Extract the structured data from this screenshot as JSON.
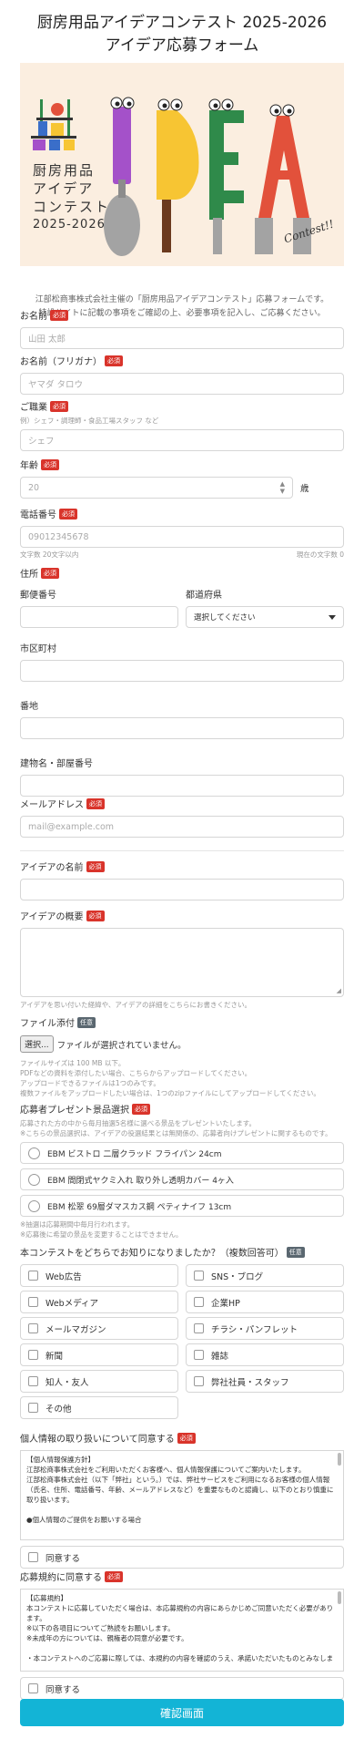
{
  "title": [
    "厨房用品アイデアコンテスト 2025-2026",
    "アイデア応募フォーム"
  ],
  "banner": {
    "text_lines": [
      "厨房用品",
      "アイデア",
      "コンテスト",
      "2025-2026"
    ],
    "logo_letters": [
      "I",
      "D",
      "E",
      "A"
    ],
    "contest_script": "Contest!!",
    "colors": {
      "bg": "#fbeee0",
      "purple": "#a451c9",
      "yellow": "#f7c533",
      "green": "#2f8a4a",
      "red": "#e2513b",
      "blue": "#3a6ec9"
    }
  },
  "intro": [
    "江部松商事株式会社主催の「厨房用品アイデアコンテスト」応募フォームです。",
    "特設サイトに記載の事項をご確認の上、必要事項を記入し、ご応募ください。"
  ],
  "badges": {
    "required": "必須",
    "optional": "任意"
  },
  "form": {
    "name": {
      "label": "お名前",
      "placeholder": "山田 太郎"
    },
    "kana": {
      "label": "お名前（フリガナ）",
      "placeholder": "ヤマダ タロウ"
    },
    "job": {
      "label": "ご職業",
      "hint": "例）シェフ・調理師・食品工場スタッフ など",
      "placeholder": "シェフ"
    },
    "age": {
      "label": "年齢",
      "value": "20",
      "unit": "歳"
    },
    "phone": {
      "label": "電話番号",
      "placeholder": "09012345678",
      "hint_left": "文字数 20文字以内",
      "hint_right": "現在の文字数 0"
    },
    "address": {
      "label": "住所",
      "zip_label": "郵便番号",
      "pref_label": "都道府県",
      "pref_value": "選択してください",
      "city_label": "市区町村",
      "street_label": "番地",
      "building_label": "建物名・部屋番号"
    },
    "email": {
      "label": "メールアドレス",
      "placeholder": "mail@example.com"
    },
    "idea_name": {
      "label": "アイデアの名前"
    },
    "idea_summary": {
      "label": "アイデアの概要",
      "hint": "アイデアを思い付いた経緯や、アイデアの詳細をこちらにお書きください。"
    },
    "file": {
      "label": "ファイル添付",
      "button": "選択...",
      "status": "ファイルが選択されていません。",
      "hints": [
        "ファイルサイズは 100 MB 以下。",
        "PDFなどの資料を添付したい場合、こちらからアップロードしてください。",
        "アップロードできるファイルは1つのみです。",
        "複数ファイルをアップロードしたい場合は、1つのzipファイルにしてアップロードしてください。"
      ]
    },
    "prize": {
      "label": "応募者プレゼント景品選択",
      "hints": [
        "応募された方の中から毎月抽選5名様に選べる景品をプレゼントいたします。",
        "※こちらの景品選択は、アイデアの役選結果とは無関係の、応募者向けプレゼントに関するものです。"
      ],
      "options": [
        "EBM ビストロ 二層クラッド フライパン 24cm",
        "EBM 間閉式ヤクミ入れ 取り外し透明カバー 4ヶ入",
        "EBM 松翠 69層ダマスカス鋼 ペティナイフ 13cm"
      ],
      "notes": [
        "※抽選は応募期間中毎月行われます。",
        "※応募後に希望の景品を変更することはできません。"
      ]
    },
    "source": {
      "label": "本コンテストをどちらでお知りになりましたか？（複数回答可）",
      "options": [
        "Web広告",
        "SNS・ブログ",
        "Webメディア",
        "企業HP",
        "メールマガジン",
        "チラシ・パンフレット",
        "新聞",
        "雑誌",
        "知人・友人",
        "弊社社員・スタッフ",
        "その他"
      ]
    },
    "privacy": {
      "label": "個人情報の取り扱いについて同意する",
      "text": [
        "【個人情報保護方針】",
        "江部松商事株式会社をご利用いただくお客様へ、個人情報保護についてご案内いたします。",
        "江部松商事株式会社（以下「弊社」という。）では、弊社サービスをご利用になるお客様の個人情報（氏名、住所、電話番号、年齢、メールアドレスなど）を重要なものと認識し、以下のとおり慎重に取り扱います。",
        "",
        "●個人情報のご提供をお願いする場合"
      ],
      "agree": "同意する"
    },
    "terms": {
      "label": "応募規約に同意する",
      "text": [
        "【応募規約】",
        "本コンテストに応募していただく場合は、本応募規約の内容にあらかじめご同意いただく必要があります。",
        "※以下の各項目についてご熟読をお願いします。",
        "※未成年の方については、親権者の同意が必要です。",
        "",
        "・本コンテストへのご応募に際しては、本規約の内容を確認のうえ、承諾いただいたものとみなしま"
      ],
      "agree": "同意する"
    },
    "submit": "確認画面"
  }
}
